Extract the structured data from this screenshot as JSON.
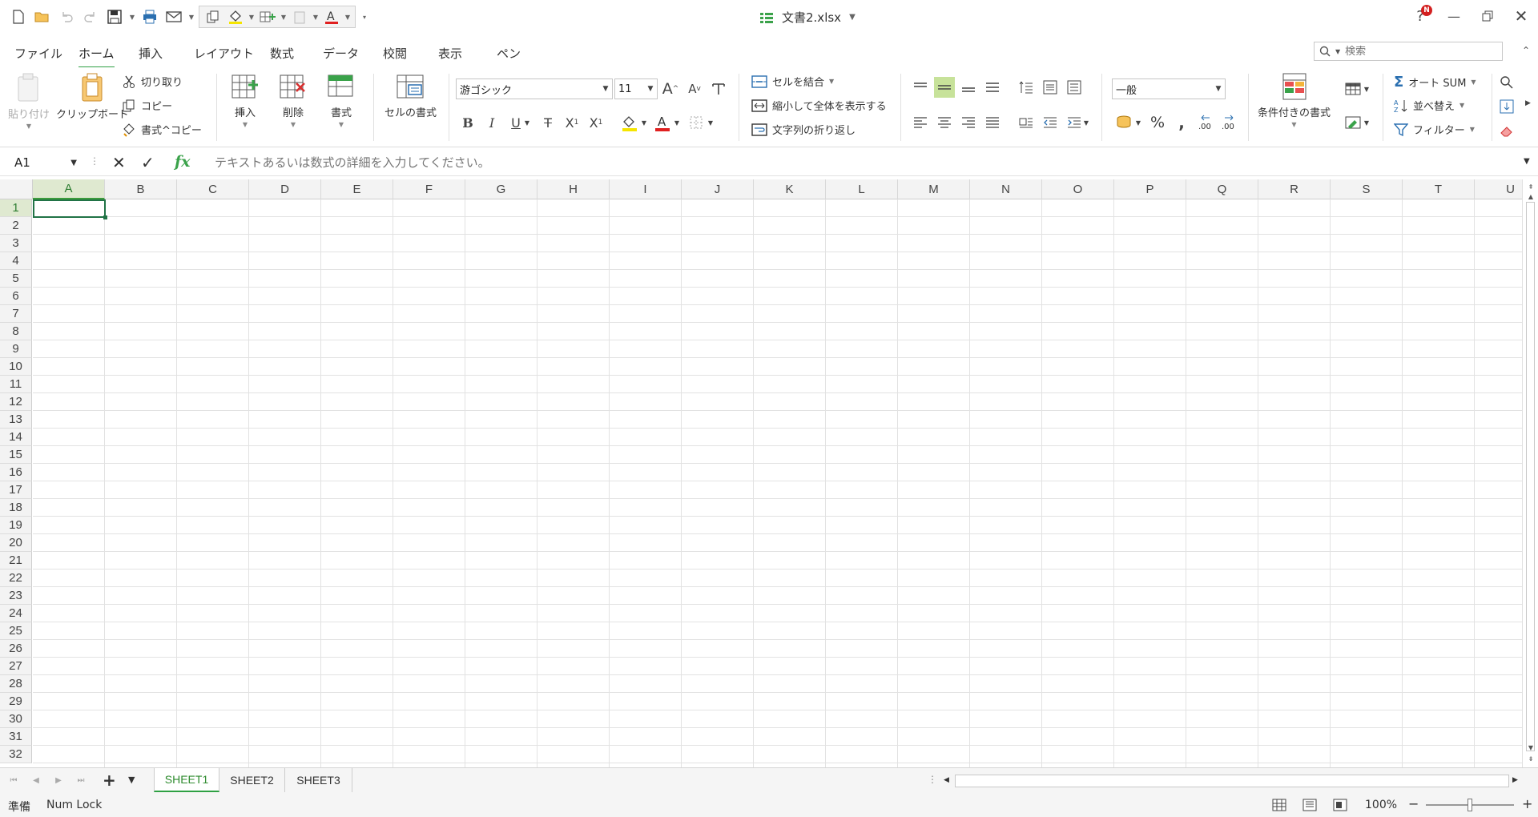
{
  "title_bar": {
    "document_name": "文書2.xlsx",
    "help_badge": "N",
    "colors": {
      "accent": "#2ea043",
      "green_icon": "#3aa24a",
      "font_red": "#e02020",
      "fill_yellow": "#f5e500"
    }
  },
  "menu": {
    "tabs": [
      {
        "label": "ファイル"
      },
      {
        "label": "ホーム",
        "active": true
      },
      {
        "label": "挿入"
      },
      {
        "label": "レイアウト"
      },
      {
        "label": "数式"
      },
      {
        "label": "データ"
      },
      {
        "label": "校閲"
      },
      {
        "label": "表示"
      },
      {
        "label": "ペン"
      }
    ],
    "search_placeholder": "検索"
  },
  "ribbon": {
    "paste": "貼り付け",
    "clipboard": "クリップボード",
    "cut": "切り取り",
    "copy": "コピー",
    "format_painter": "書式^コピー",
    "insert": "挿入",
    "delete": "削除",
    "format": "書式",
    "cell_format": "セルの書式",
    "font_name": "游ゴシック",
    "font_size": "11",
    "merge_cells": "セルを結合",
    "shrink_to_fit": "縮小して全体を表示する",
    "wrap_text": "文字列の折り返し",
    "number_format": "一般",
    "conditional_format": "条件付きの書式",
    "autosum": "オート SUM",
    "sort": "並べ替え",
    "filter": "フィルター"
  },
  "formula_bar": {
    "name_box": "A1",
    "fx": "fx",
    "placeholder": "テキストあるいは数式の詳細を入力してください。"
  },
  "grid": {
    "columns": [
      "A",
      "B",
      "C",
      "D",
      "E",
      "F",
      "G",
      "H",
      "I",
      "J",
      "K",
      "L",
      "M",
      "N",
      "O",
      "P",
      "Q",
      "R",
      "S",
      "T",
      "U"
    ],
    "rows": [
      "1",
      "2",
      "3",
      "4",
      "5",
      "6",
      "7",
      "8",
      "9",
      "10",
      "11",
      "12",
      "13",
      "14",
      "15",
      "16",
      "17",
      "18",
      "19",
      "20",
      "21",
      "22",
      "23",
      "24",
      "25",
      "26",
      "27",
      "28",
      "29",
      "30",
      "31",
      "32"
    ],
    "active_cell": "A1"
  },
  "sheets": {
    "tabs": [
      {
        "label": "SHEET1",
        "active": true
      },
      {
        "label": "SHEET2"
      },
      {
        "label": "SHEET3"
      }
    ]
  },
  "status": {
    "mode": "準備",
    "num_lock": "Num Lock",
    "zoom": "100%"
  }
}
